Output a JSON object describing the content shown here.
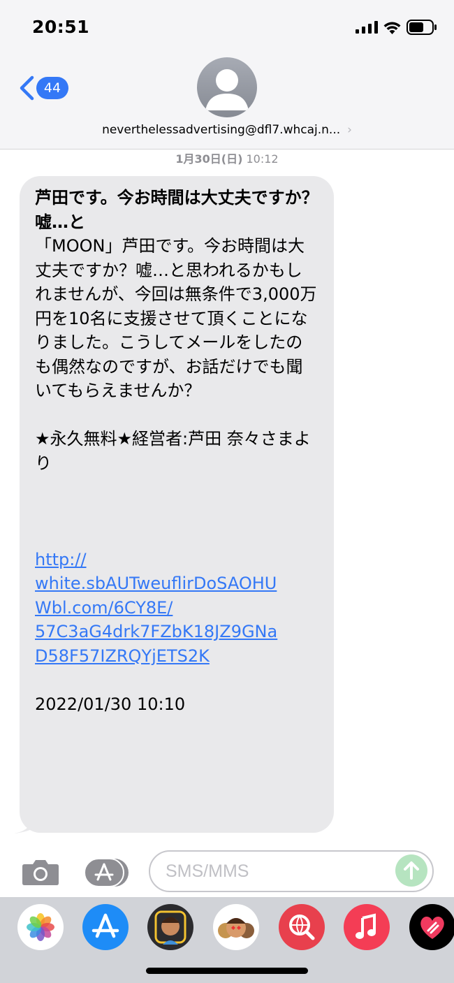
{
  "status_bar": {
    "time": "20:51"
  },
  "header": {
    "back_count": "44",
    "contact": "neverthelessadvertising@dfl7.whcaj.n...",
    "contact_chevron": "›"
  },
  "conversation": {
    "timestamp_date": "1月30日(日)",
    "timestamp_time": "10:12",
    "message": {
      "title": "芦田です。今お時間は大丈夫ですか？嘘…と",
      "body": "「MOON」芦田です。今お時間は大丈夫ですか？嘘…と思われるかもしれませんが、今回は無条件で3,000万円を10名に支援させて頂くことになりました。こうしてメールをしたのも偶然なのですが、お話だけでも聞いてもらえませんか？",
      "sign": "★永久無料★経営者:芦田 奈々さまより",
      "link_lines": [
        "http://",
        "white.sbAUTweuflirDoSAOHU",
        "Wbl.com/6CY8E/",
        "57C3aG4drk7FZbK18JZ9GNa",
        "D58F57IZRQYjETS2K"
      ],
      "date": "2022/01/30 10:10"
    }
  },
  "composer": {
    "placeholder": "SMS/MMS"
  },
  "tray_apps": [
    "photos-icon",
    "app-store-icon",
    "memoji-stickers-icon",
    "animoji-icon",
    "web-search-icon",
    "music-icon",
    "digital-touch-icon"
  ],
  "colors": {
    "accent": "#3478f6",
    "bubble": "#e9e9eb",
    "send": "#b6e4c0",
    "tray": "#d1d3d8"
  }
}
